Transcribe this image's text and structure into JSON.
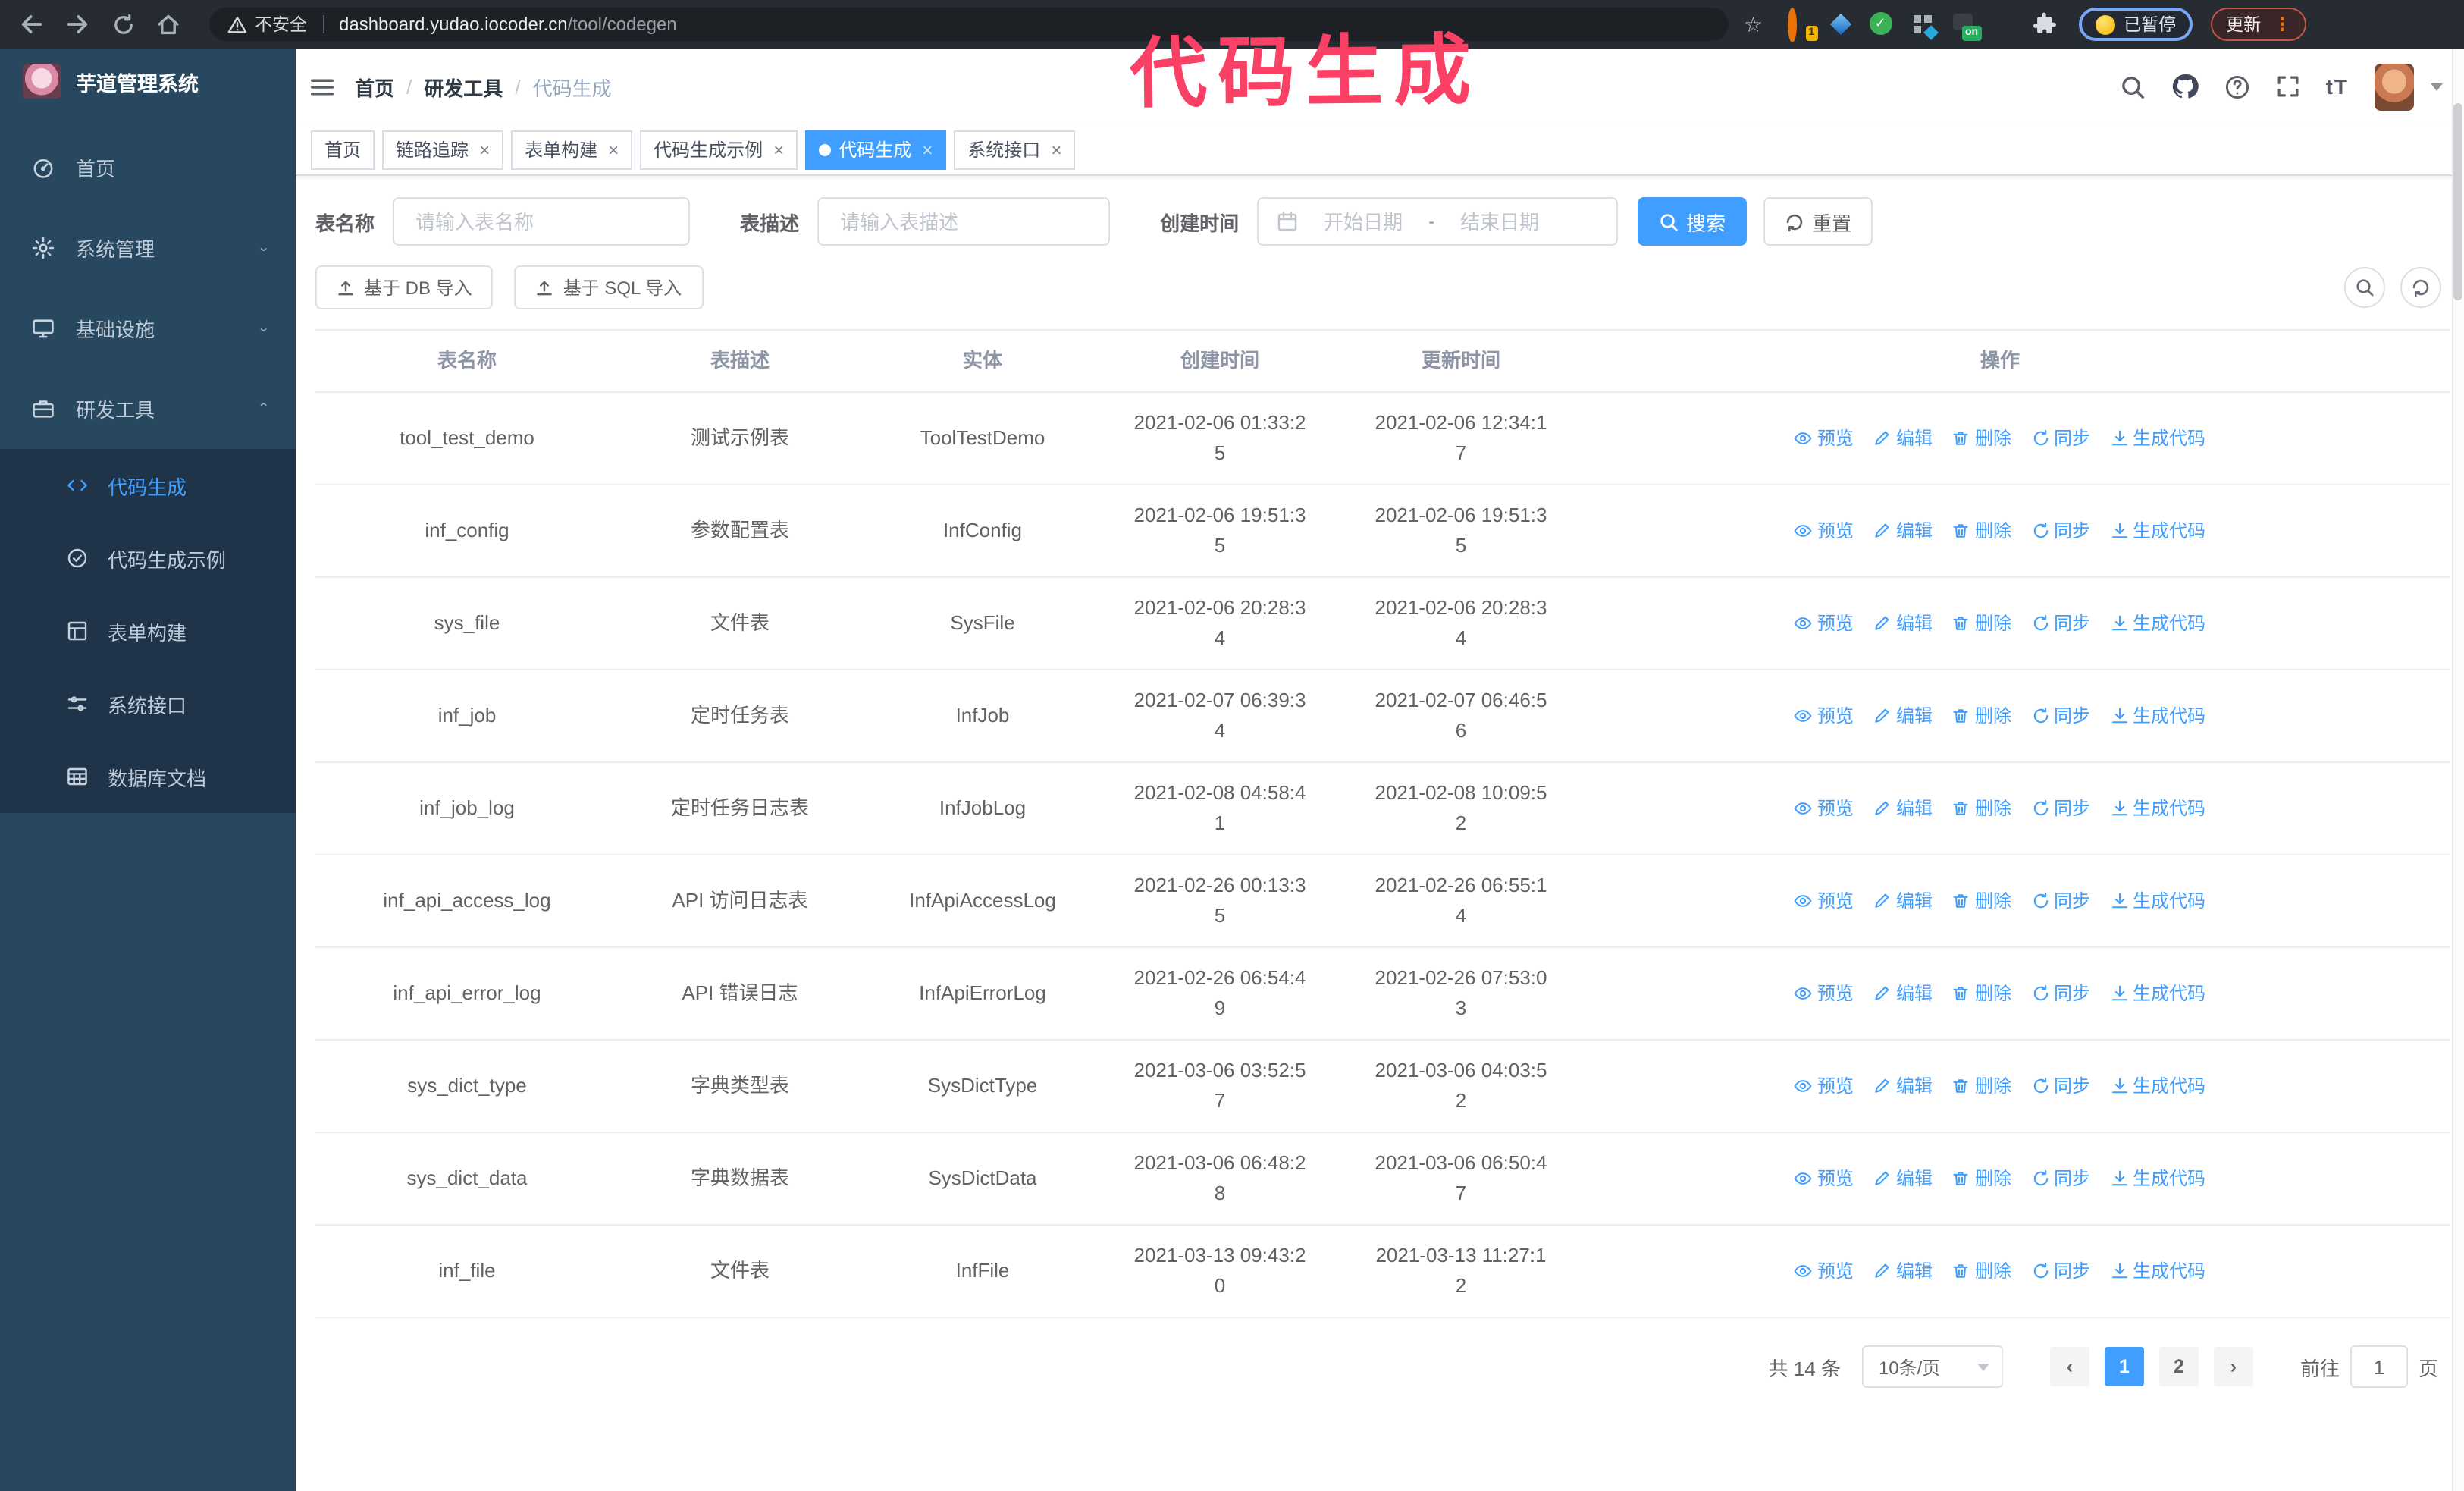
{
  "browser": {
    "security_label": "不安全",
    "url_host": "dashboard.yudao.iocoder.cn",
    "url_path": "/tool/codegen",
    "ext_badge_count": "1",
    "ext_on_badge": "on",
    "paused_label": "已暂停",
    "update_label": "更新"
  },
  "annotation": {
    "text": "代码生成",
    "color": "#fa4064"
  },
  "sidebar": {
    "title": "芋道管理系统",
    "menu": [
      {
        "label": "首页",
        "icon": "dashboard",
        "arrow": "none"
      },
      {
        "label": "系统管理",
        "icon": "gear",
        "arrow": "down"
      },
      {
        "label": "基础设施",
        "icon": "monitor",
        "arrow": "down"
      },
      {
        "label": "研发工具",
        "icon": "briefcase",
        "arrow": "up"
      }
    ],
    "submenu": [
      {
        "label": "代码生成",
        "icon": "code",
        "active": true
      },
      {
        "label": "代码生成示例",
        "icon": "circle-check",
        "active": false
      },
      {
        "label": "表单构建",
        "icon": "grid",
        "active": false
      },
      {
        "label": "系统接口",
        "icon": "sliders",
        "active": false
      },
      {
        "label": "数据库文档",
        "icon": "dbtable",
        "active": false
      }
    ]
  },
  "header": {
    "breadcrumb": [
      "首页",
      "研发工具",
      "代码生成"
    ]
  },
  "tabs": [
    {
      "label": "首页",
      "closable": false,
      "active": false
    },
    {
      "label": "链路追踪",
      "closable": true,
      "active": false
    },
    {
      "label": "表单构建",
      "closable": true,
      "active": false
    },
    {
      "label": "代码生成示例",
      "closable": true,
      "active": false
    },
    {
      "label": "代码生成",
      "closable": true,
      "active": true
    },
    {
      "label": "系统接口",
      "closable": true,
      "active": false
    }
  ],
  "filters": {
    "name_label": "表名称",
    "name_placeholder": "请输入表名称",
    "desc_label": "表描述",
    "desc_placeholder": "请输入表描述",
    "time_label": "创建时间",
    "start_placeholder": "开始日期",
    "separator": "-",
    "end_placeholder": "结束日期",
    "search_label": "搜索",
    "reset_label": "重置"
  },
  "toolbar": {
    "import_db": "基于 DB 导入",
    "import_sql": "基于 SQL 导入"
  },
  "table": {
    "columns": [
      "表名称",
      "表描述",
      "实体",
      "创建时间",
      "更新时间",
      "操作"
    ],
    "actions": [
      "预览",
      "编辑",
      "删除",
      "同步",
      "生成代码"
    ],
    "rows": [
      {
        "name": "tool_test_demo",
        "desc": "测试示例表",
        "entity": "ToolTestDemo",
        "created": "2021-02-06 01:33:25",
        "updated": "2021-02-06 12:34:17"
      },
      {
        "name": "inf_config",
        "desc": "参数配置表",
        "entity": "InfConfig",
        "created": "2021-02-06 19:51:35",
        "updated": "2021-02-06 19:51:35"
      },
      {
        "name": "sys_file",
        "desc": "文件表",
        "entity": "SysFile",
        "created": "2021-02-06 20:28:34",
        "updated": "2021-02-06 20:28:34"
      },
      {
        "name": "inf_job",
        "desc": "定时任务表",
        "entity": "InfJob",
        "created": "2021-02-07 06:39:34",
        "updated": "2021-02-07 06:46:56"
      },
      {
        "name": "inf_job_log",
        "desc": "定时任务日志表",
        "entity": "InfJobLog",
        "created": "2021-02-08 04:58:41",
        "updated": "2021-02-08 10:09:52"
      },
      {
        "name": "inf_api_access_log",
        "desc": "API 访问日志表",
        "entity": "InfApiAccessLog",
        "created": "2021-02-26 00:13:35",
        "updated": "2021-02-26 06:55:14"
      },
      {
        "name": "inf_api_error_log",
        "desc": "API 错误日志",
        "entity": "InfApiErrorLog",
        "created": "2021-02-26 06:54:49",
        "updated": "2021-02-26 07:53:03"
      },
      {
        "name": "sys_dict_type",
        "desc": "字典类型表",
        "entity": "SysDictType",
        "created": "2021-03-06 03:52:57",
        "updated": "2021-03-06 04:03:52"
      },
      {
        "name": "sys_dict_data",
        "desc": "字典数据表",
        "entity": "SysDictData",
        "created": "2021-03-06 06:48:28",
        "updated": "2021-03-06 06:50:47"
      },
      {
        "name": "inf_file",
        "desc": "文件表",
        "entity": "InfFile",
        "created": "2021-03-13 09:43:20",
        "updated": "2021-03-13 11:27:12"
      }
    ]
  },
  "pagination": {
    "total": "共 14 条",
    "page_size": "10条/页",
    "pages": [
      "1",
      "2"
    ],
    "active_page": "1",
    "goto_label": "前往",
    "goto_value": "1",
    "goto_suffix": "页"
  },
  "colors": {
    "accent": "#409eff",
    "sidebar_bg": "#27485f",
    "submenu_bg": "#1f3449"
  }
}
